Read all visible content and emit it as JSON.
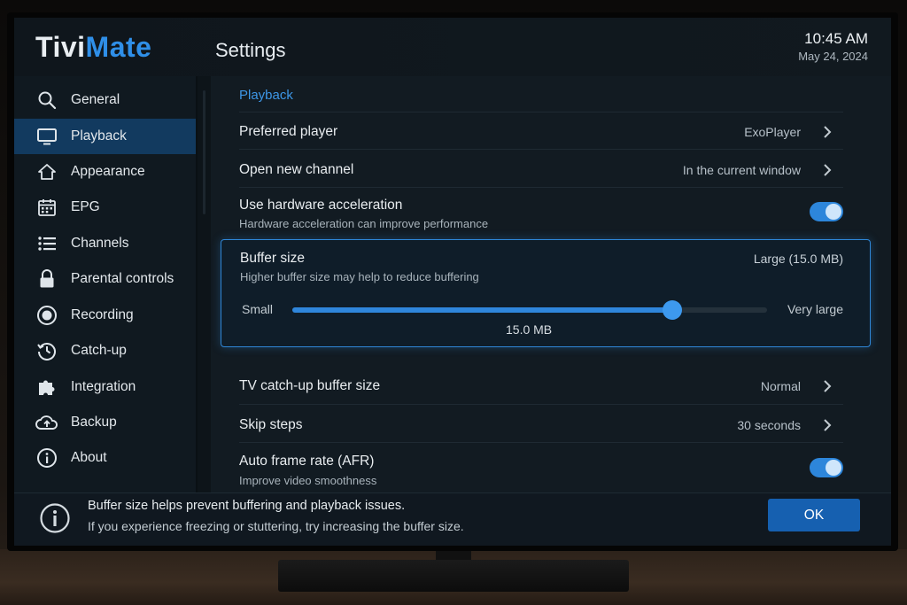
{
  "app": {
    "logo_part1": "Tivi",
    "logo_part2": "Mate",
    "title": "Settings"
  },
  "clock": {
    "time": "10:45 AM",
    "date": "May 24, 2024"
  },
  "sidebar": {
    "active": "Playback",
    "items": [
      {
        "label": "General",
        "icon": "search-icon"
      },
      {
        "label": "Playback",
        "icon": "monitor-icon"
      },
      {
        "label": "Appearance",
        "icon": "home-icon"
      },
      {
        "label": "EPG",
        "icon": "calendar-icon"
      },
      {
        "label": "Channels",
        "icon": "list-icon"
      },
      {
        "label": "Parental controls",
        "icon": "lock-icon"
      },
      {
        "label": "Recording",
        "icon": "record-icon"
      },
      {
        "label": "Catch-up",
        "icon": "history-icon"
      },
      {
        "label": "Integration",
        "icon": "puzzle-icon"
      },
      {
        "label": "Backup",
        "icon": "cloud-icon"
      },
      {
        "label": "About",
        "icon": "info-icon"
      }
    ]
  },
  "content": {
    "section_title": "Playback",
    "preferred_player": {
      "title": "Preferred player",
      "value": "ExoPlayer"
    },
    "open_new_channel": {
      "title": "Open new channel",
      "value": "In the current window"
    },
    "hw_accel": {
      "title": "Use hardware acceleration",
      "subtitle": "Hardware acceleration can improve performance",
      "enabled": true
    },
    "buffer": {
      "title": "Buffer size",
      "subtitle": "Higher buffer size may help to reduce buffering",
      "value": "Large (15.0 MB)",
      "min_label": "Small",
      "max_label": "Very large",
      "current_label": "15.0 MB",
      "fraction": 0.8
    },
    "tv_catchup": {
      "title": "TV catch-up buffer size",
      "value": "Normal"
    },
    "skip_steps": {
      "title": "Skip steps",
      "value": "30 seconds"
    },
    "afr": {
      "title": "Auto frame rate (AFR)",
      "subtitle": "Improve video smoothness",
      "enabled": true
    }
  },
  "footer": {
    "line1": "Buffer size helps prevent buffering and playback issues.",
    "line2": "If you experience freezing or stuttering, try increasing the buffer size.",
    "ok_label": "OK"
  },
  "colors": {
    "accent": "#2f86db",
    "active_bg": "#123a5f",
    "background": "#0d1419"
  }
}
